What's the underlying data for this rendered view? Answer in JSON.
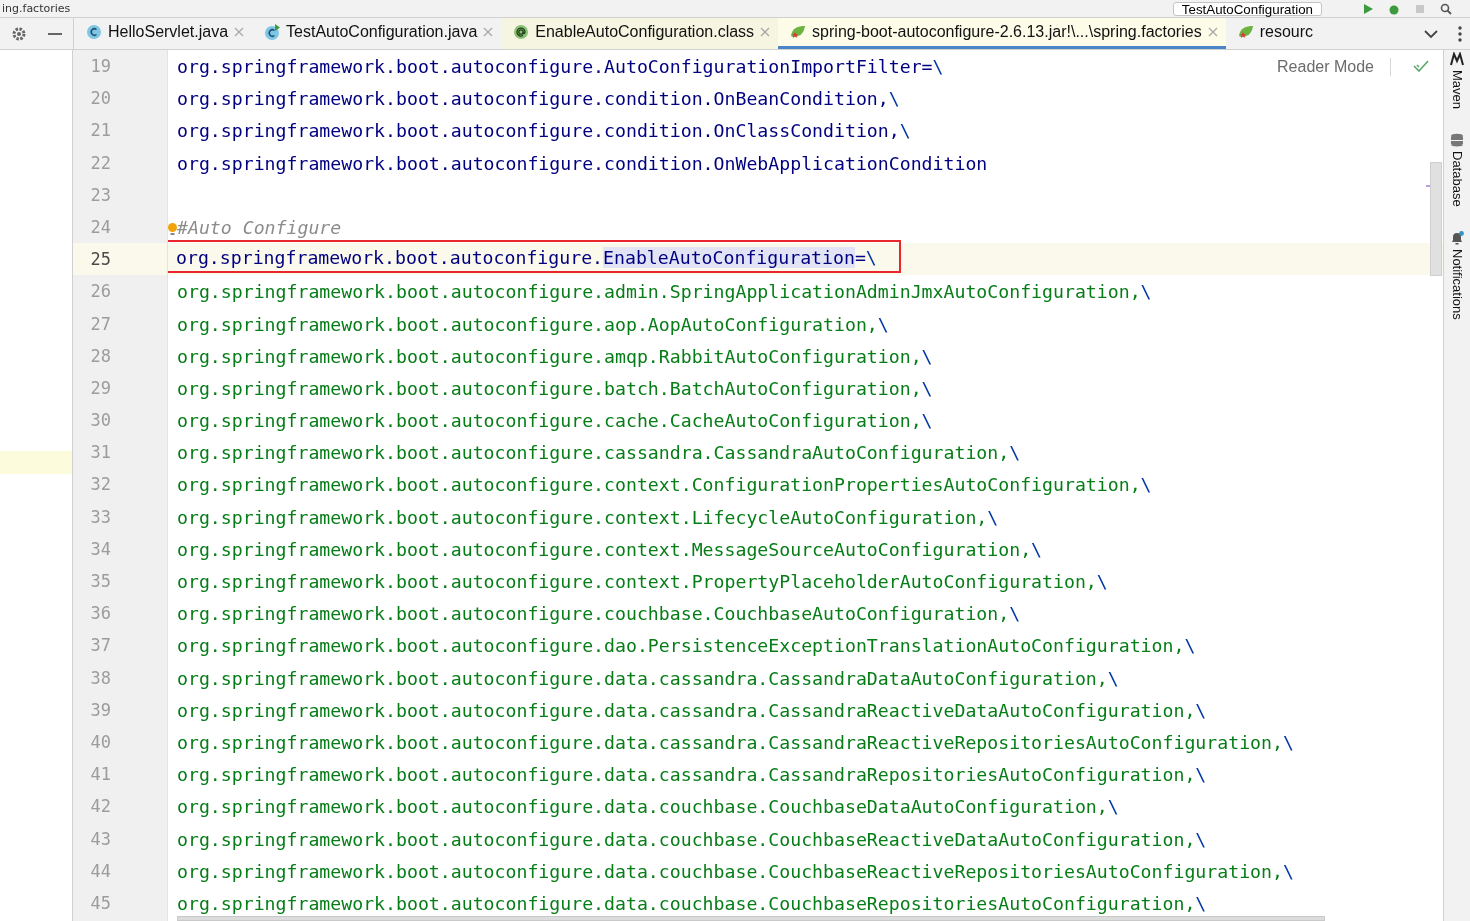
{
  "top_strip": {
    "file_title": "ing.factories",
    "run_config": "TestAutoConfiguration"
  },
  "tabs": [
    {
      "label": "HelloServlet.java",
      "kind": "class",
      "library": false,
      "selected": false,
      "closable": true
    },
    {
      "label": "TestAutoConfiguration.java",
      "kind": "class-run",
      "library": false,
      "selected": false,
      "closable": true
    },
    {
      "label": "EnableAutoConfiguration.class",
      "kind": "annotation",
      "library": true,
      "selected": false,
      "closable": true
    },
    {
      "label": "spring-boot-autoconfigure-2.6.13.jar!\\...\\spring.factories",
      "kind": "spring",
      "library": true,
      "selected": true,
      "closable": true
    },
    {
      "label": "resourc",
      "kind": "spring",
      "library": false,
      "selected": false,
      "closable": false
    }
  ],
  "editor": {
    "reader_mode": "Reader Mode",
    "lines": [
      {
        "number": "19",
        "current": false,
        "boxed": false,
        "bulb": false,
        "segments": [
          {
            "kind": "key",
            "text": "org.springframework.boot.autoconfigure.AutoConfigurationImportFilter="
          },
          {
            "kind": "escape",
            "text": "\\"
          }
        ]
      },
      {
        "number": "20",
        "current": false,
        "boxed": false,
        "bulb": false,
        "segments": [
          {
            "kind": "key",
            "text": "org.springframework.boot.autoconfigure.condition.OnBeanCondition,"
          },
          {
            "kind": "escape",
            "text": "\\"
          }
        ]
      },
      {
        "number": "21",
        "current": false,
        "boxed": false,
        "bulb": false,
        "segments": [
          {
            "kind": "key",
            "text": "org.springframework.boot.autoconfigure.condition.OnClassCondition,"
          },
          {
            "kind": "escape",
            "text": "\\"
          }
        ]
      },
      {
        "number": "22",
        "current": false,
        "boxed": false,
        "bulb": false,
        "segments": [
          {
            "kind": "key",
            "text": "org.springframework.boot.autoconfigure.condition.OnWebApplicationCondition"
          }
        ]
      },
      {
        "number": "23",
        "current": false,
        "boxed": false,
        "bulb": false
      },
      {
        "number": "24",
        "current": false,
        "boxed": false,
        "bulb": true,
        "segments": [
          {
            "kind": "comment",
            "text": "#Auto Configure"
          }
        ]
      },
      {
        "number": "25",
        "current": true,
        "boxed": true,
        "bulb": false,
        "segments": [
          {
            "kind": "key",
            "text": "org.springframework.boot.autoconfigure."
          },
          {
            "kind": "match",
            "text": "EnableAutoConfiguration"
          },
          {
            "kind": "key",
            "text": "="
          },
          {
            "kind": "escape",
            "text": "\\"
          }
        ]
      },
      {
        "number": "26",
        "current": false,
        "boxed": false,
        "bulb": false,
        "segments": [
          {
            "kind": "value",
            "text": "org.springframework.boot.autoconfigure.admin.SpringApplicationAdminJmxAutoConfiguration,"
          },
          {
            "kind": "escape",
            "text": "\\"
          }
        ]
      },
      {
        "number": "27",
        "current": false,
        "boxed": false,
        "bulb": false,
        "segments": [
          {
            "kind": "value",
            "text": "org.springframework.boot.autoconfigure.aop.AopAutoConfiguration,"
          },
          {
            "kind": "escape",
            "text": "\\"
          }
        ]
      },
      {
        "number": "28",
        "current": false,
        "boxed": false,
        "bulb": false,
        "segments": [
          {
            "kind": "value",
            "text": "org.springframework.boot.autoconfigure.amqp.RabbitAutoConfiguration,"
          },
          {
            "kind": "escape",
            "text": "\\"
          }
        ]
      },
      {
        "number": "29",
        "current": false,
        "boxed": false,
        "bulb": false,
        "segments": [
          {
            "kind": "value",
            "text": "org.springframework.boot.autoconfigure.batch.BatchAutoConfiguration,"
          },
          {
            "kind": "escape",
            "text": "\\"
          }
        ]
      },
      {
        "number": "30",
        "current": false,
        "boxed": false,
        "bulb": false,
        "segments": [
          {
            "kind": "value",
            "text": "org.springframework.boot.autoconfigure.cache.CacheAutoConfiguration,"
          },
          {
            "kind": "escape",
            "text": "\\"
          }
        ]
      },
      {
        "number": "31",
        "current": false,
        "boxed": false,
        "bulb": false,
        "segments": [
          {
            "kind": "value",
            "text": "org.springframework.boot.autoconfigure.cassandra.CassandraAutoConfiguration,"
          },
          {
            "kind": "escape",
            "text": "\\"
          }
        ]
      },
      {
        "number": "32",
        "current": false,
        "boxed": false,
        "bulb": false,
        "segments": [
          {
            "kind": "value",
            "text": "org.springframework.boot.autoconfigure.context.ConfigurationPropertiesAutoConfiguration,"
          },
          {
            "kind": "escape",
            "text": "\\"
          }
        ]
      },
      {
        "number": "33",
        "current": false,
        "boxed": false,
        "bulb": false,
        "segments": [
          {
            "kind": "value",
            "text": "org.springframework.boot.autoconfigure.context.LifecycleAutoConfiguration,"
          },
          {
            "kind": "escape",
            "text": "\\"
          }
        ]
      },
      {
        "number": "34",
        "current": false,
        "boxed": false,
        "bulb": false,
        "segments": [
          {
            "kind": "value",
            "text": "org.springframework.boot.autoconfigure.context.MessageSourceAutoConfiguration,"
          },
          {
            "kind": "escape",
            "text": "\\"
          }
        ]
      },
      {
        "number": "35",
        "current": false,
        "boxed": false,
        "bulb": false,
        "segments": [
          {
            "kind": "value",
            "text": "org.springframework.boot.autoconfigure.context.PropertyPlaceholderAutoConfiguration,"
          },
          {
            "kind": "escape",
            "text": "\\"
          }
        ]
      },
      {
        "number": "36",
        "current": false,
        "boxed": false,
        "bulb": false,
        "segments": [
          {
            "kind": "value",
            "text": "org.springframework.boot.autoconfigure.couchbase.CouchbaseAutoConfiguration,"
          },
          {
            "kind": "escape",
            "text": "\\"
          }
        ]
      },
      {
        "number": "37",
        "current": false,
        "boxed": false,
        "bulb": false,
        "segments": [
          {
            "kind": "value",
            "text": "org.springframework.boot.autoconfigure.dao.PersistenceExceptionTranslationAutoConfiguration,"
          },
          {
            "kind": "escape",
            "text": "\\"
          }
        ]
      },
      {
        "number": "38",
        "current": false,
        "boxed": false,
        "bulb": false,
        "segments": [
          {
            "kind": "value",
            "text": "org.springframework.boot.autoconfigure.data.cassandra.CassandraDataAutoConfiguration,"
          },
          {
            "kind": "escape",
            "text": "\\"
          }
        ]
      },
      {
        "number": "39",
        "current": false,
        "boxed": false,
        "bulb": false,
        "segments": [
          {
            "kind": "value",
            "text": "org.springframework.boot.autoconfigure.data.cassandra.CassandraReactiveDataAutoConfiguration,"
          },
          {
            "kind": "escape",
            "text": "\\"
          }
        ]
      },
      {
        "number": "40",
        "current": false,
        "boxed": false,
        "bulb": false,
        "segments": [
          {
            "kind": "value",
            "text": "org.springframework.boot.autoconfigure.data.cassandra.CassandraReactiveRepositoriesAutoConfiguration,"
          },
          {
            "kind": "escape",
            "text": "\\"
          }
        ]
      },
      {
        "number": "41",
        "current": false,
        "boxed": false,
        "bulb": false,
        "segments": [
          {
            "kind": "value",
            "text": "org.springframework.boot.autoconfigure.data.cassandra.CassandraRepositoriesAutoConfiguration,"
          },
          {
            "kind": "escape",
            "text": "\\"
          }
        ]
      },
      {
        "number": "42",
        "current": false,
        "boxed": false,
        "bulb": false,
        "segments": [
          {
            "kind": "value",
            "text": "org.springframework.boot.autoconfigure.data.couchbase.CouchbaseDataAutoConfiguration,"
          },
          {
            "kind": "escape",
            "text": "\\"
          }
        ]
      },
      {
        "number": "43",
        "current": false,
        "boxed": false,
        "bulb": false,
        "segments": [
          {
            "kind": "value",
            "text": "org.springframework.boot.autoconfigure.data.couchbase.CouchbaseReactiveDataAutoConfiguration,"
          },
          {
            "kind": "escape",
            "text": "\\"
          }
        ]
      },
      {
        "number": "44",
        "current": false,
        "boxed": false,
        "bulb": false,
        "segments": [
          {
            "kind": "value",
            "text": "org.springframework.boot.autoconfigure.data.couchbase.CouchbaseReactiveRepositoriesAutoConfiguration,"
          },
          {
            "kind": "escape",
            "text": "\\"
          }
        ]
      },
      {
        "number": "45",
        "current": false,
        "boxed": false,
        "bulb": false,
        "segments": [
          {
            "kind": "value",
            "text": "org.springframework.boot.autoconfigure.data.couchbase.CouchbaseRepositoriesAutoConfiguration,"
          },
          {
            "kind": "escape",
            "text": "\\"
          }
        ]
      }
    ]
  },
  "right_toolbar": [
    {
      "label": "Maven",
      "kind": "maven"
    },
    {
      "label": "Database",
      "kind": "database"
    },
    {
      "label": "Notifications",
      "kind": "bell"
    }
  ]
}
